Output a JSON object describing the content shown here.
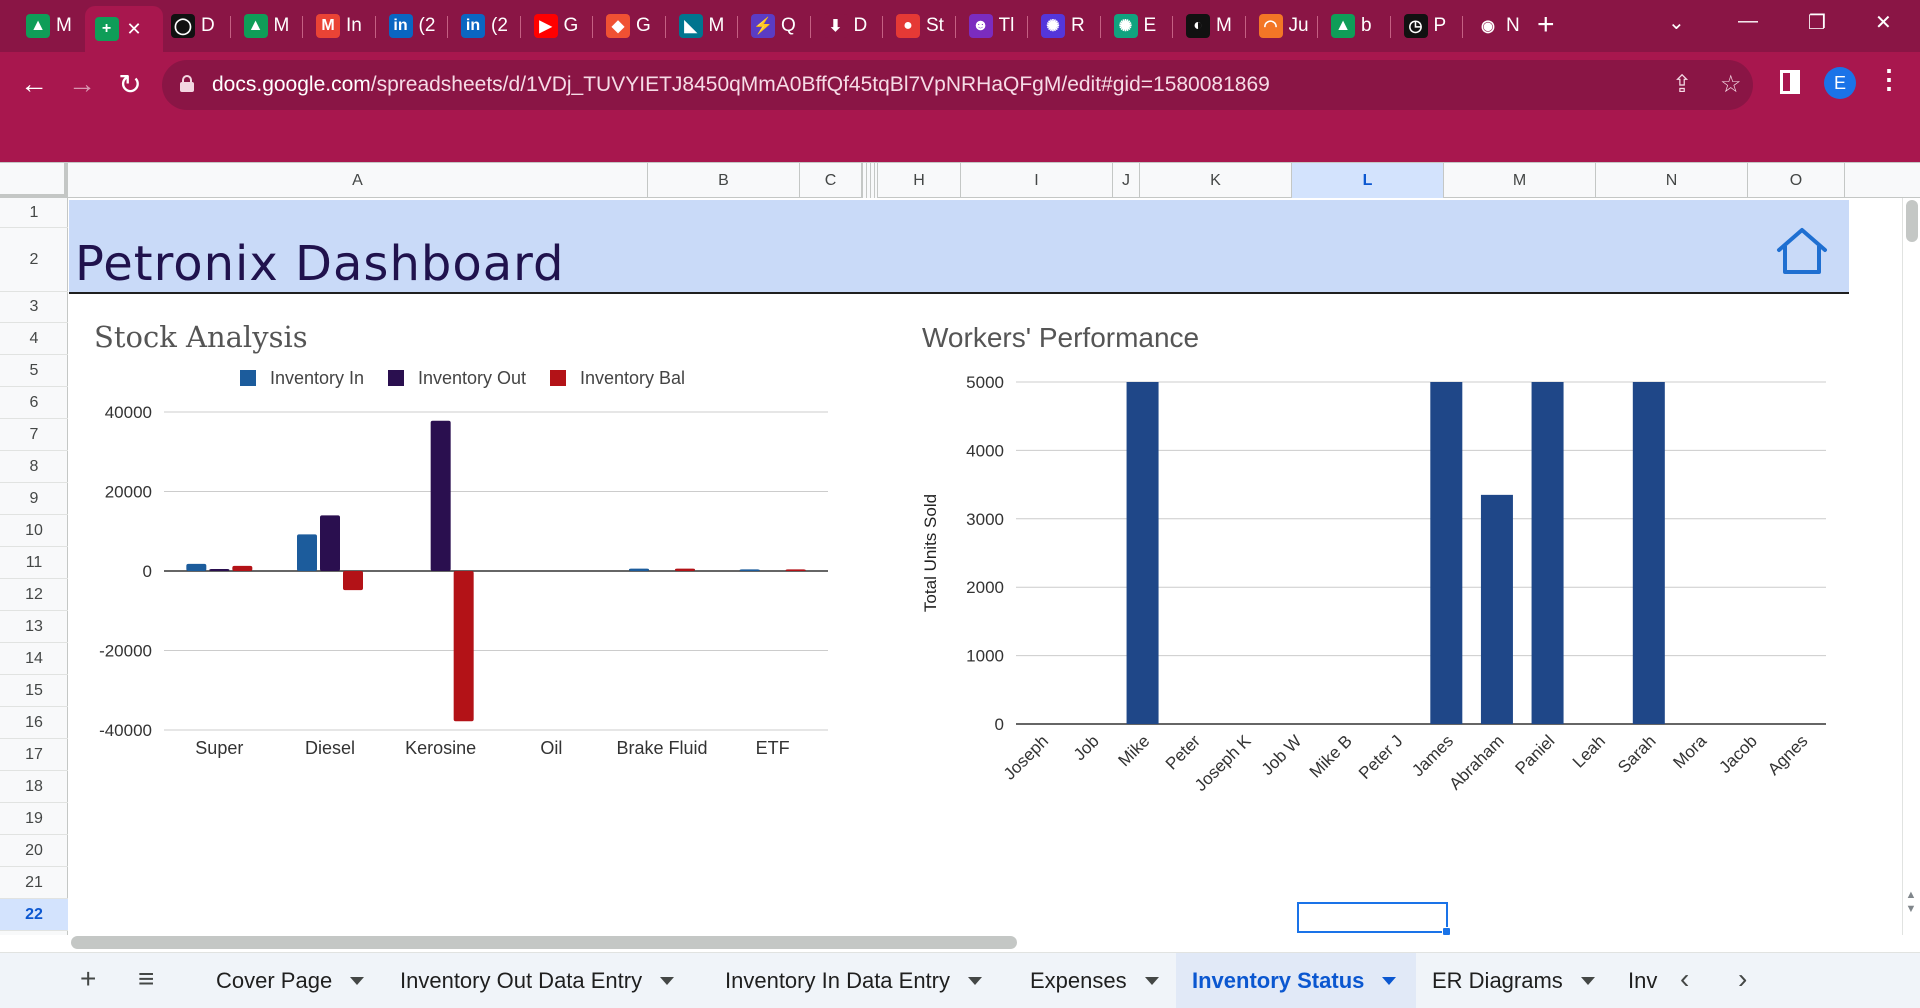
{
  "browser": {
    "tabs": [
      {
        "label": "M",
        "icon": "google-drive-icon",
        "color": "#0f9d58",
        "glyph": "▲"
      },
      {
        "label": "",
        "icon": "google-sheets-icon",
        "color": "#0f9d58",
        "glyph": "+",
        "active": true
      },
      {
        "label": "D",
        "icon": "dark-circle-icon",
        "color": "#111111",
        "glyph": "◯"
      },
      {
        "label": "M",
        "icon": "google-drive-icon",
        "color": "#0f9d58",
        "glyph": "▲"
      },
      {
        "label": "In",
        "icon": "gmail-icon",
        "color": "#ea4335",
        "glyph": "M"
      },
      {
        "label": "(2",
        "icon": "linkedin-icon",
        "color": "#0a66c2",
        "glyph": "in"
      },
      {
        "label": "(2",
        "icon": "linkedin-icon",
        "color": "#0a66c2",
        "glyph": "in"
      },
      {
        "label": "G",
        "icon": "youtube-icon",
        "color": "#ff0000",
        "glyph": "▶"
      },
      {
        "label": "G",
        "icon": "git-icon",
        "color": "#f05133",
        "glyph": "◆"
      },
      {
        "label": "M",
        "icon": "mysql-icon",
        "color": "#00758f",
        "glyph": "◣"
      },
      {
        "label": "Q",
        "icon": "bolt-icon",
        "color": "#5b3cc4",
        "glyph": "⚡"
      },
      {
        "label": "D",
        "icon": "download-icon",
        "color": "#8a1545",
        "glyph": "⬇"
      },
      {
        "label": "St",
        "icon": "pin-icon",
        "color": "#e53935",
        "glyph": "●"
      },
      {
        "label": "Tl",
        "icon": "team-icon",
        "color": "#7b2cbf",
        "glyph": "☻"
      },
      {
        "label": "R",
        "icon": "openai-icon",
        "color": "#5436da",
        "glyph": "✺"
      },
      {
        "label": "E",
        "icon": "chatgpt-icon",
        "color": "#10a37f",
        "glyph": "✺"
      },
      {
        "label": "M",
        "icon": "github-icon",
        "color": "#111111",
        "glyph": "◐"
      },
      {
        "label": "Ju",
        "icon": "jupyter-icon",
        "color": "#f37626",
        "glyph": "◠"
      },
      {
        "label": "b",
        "icon": "google-drive-icon",
        "color": "#0f9d58",
        "glyph": "▲"
      },
      {
        "label": "P",
        "icon": "compass-icon",
        "color": "#111111",
        "glyph": "◷"
      },
      {
        "label": "N",
        "icon": "chrome-icon",
        "color": "#ffffff",
        "glyph": "◉"
      }
    ],
    "url_host": "docs.google.com",
    "url_path": "/spreadsheets/d/1VDj_TUVYIETJ8450qMmA0BffQf45tqBl7VpNRHaQFgM/edit#gid=1580081869",
    "profile_initial": "E"
  },
  "sheet": {
    "columns": [
      "A",
      "B",
      "C",
      "H",
      "I",
      "J",
      "K",
      "L",
      "M",
      "N",
      "O"
    ],
    "selected_column": "L",
    "rows": [
      "1",
      "2",
      "3",
      "4",
      "5",
      "6",
      "7",
      "8",
      "9",
      "10",
      "11",
      "12",
      "13",
      "14",
      "15",
      "16",
      "17",
      "18",
      "19",
      "20",
      "21",
      "22"
    ],
    "selected_row": "22",
    "title": "Petronix Dashboard",
    "home_icon": "home-icon"
  },
  "chart_data": [
    {
      "type": "bar",
      "title": "Stock Analysis",
      "categories": [
        "Super",
        "Diesel",
        "Kerosine",
        "Oil",
        "Brake Fluid",
        "ETF"
      ],
      "series": [
        {
          "name": "Inventory In",
          "color": "#1c5c9c",
          "values": [
            1800,
            9200,
            0,
            0,
            600,
            400
          ]
        },
        {
          "name": "Inventory Out",
          "color": "#2a0f4f",
          "values": [
            500,
            14000,
            37800,
            0,
            0,
            0
          ]
        },
        {
          "name": "Inventory Bal",
          "color": "#b31217",
          "values": [
            1300,
            -4800,
            -37800,
            0,
            600,
            400
          ]
        }
      ],
      "y_ticks": [
        "40000",
        "20000",
        "0",
        "-20000",
        "-40000"
      ],
      "ylim": [
        -40000,
        40000
      ],
      "grid": true,
      "legend": "top"
    },
    {
      "type": "bar",
      "title": "Workers' Performance",
      "ylabel": "Total Units Sold",
      "categories": [
        "Joseph",
        "Job",
        "Mike",
        "Peter",
        "Joseph K",
        "Job W",
        "Mike B",
        "Peter J",
        "James",
        "Abraham",
        "Paniel",
        "Leah",
        "Sarah",
        "Mora",
        "Jacob",
        "Agnes"
      ],
      "series": [
        {
          "color": "#1f4788",
          "values": [
            0,
            0,
            5000,
            0,
            0,
            0,
            0,
            0,
            5000,
            3350,
            5000,
            0,
            5000,
            0,
            0,
            0
          ]
        }
      ],
      "y_ticks": [
        "5000",
        "4000",
        "3000",
        "2000",
        "1000",
        "0"
      ],
      "ylim": [
        0,
        5000
      ],
      "grid": true,
      "legend": "none"
    }
  ],
  "sheet_tabs": [
    {
      "label": "Cover Page"
    },
    {
      "label": "Inventory Out Data Entry"
    },
    {
      "label": "Inventory In Data Entry"
    },
    {
      "label": "Expenses"
    },
    {
      "label": "Inventory Status",
      "active": true
    },
    {
      "label": "ER Diagrams"
    },
    {
      "label": "Inv"
    }
  ]
}
